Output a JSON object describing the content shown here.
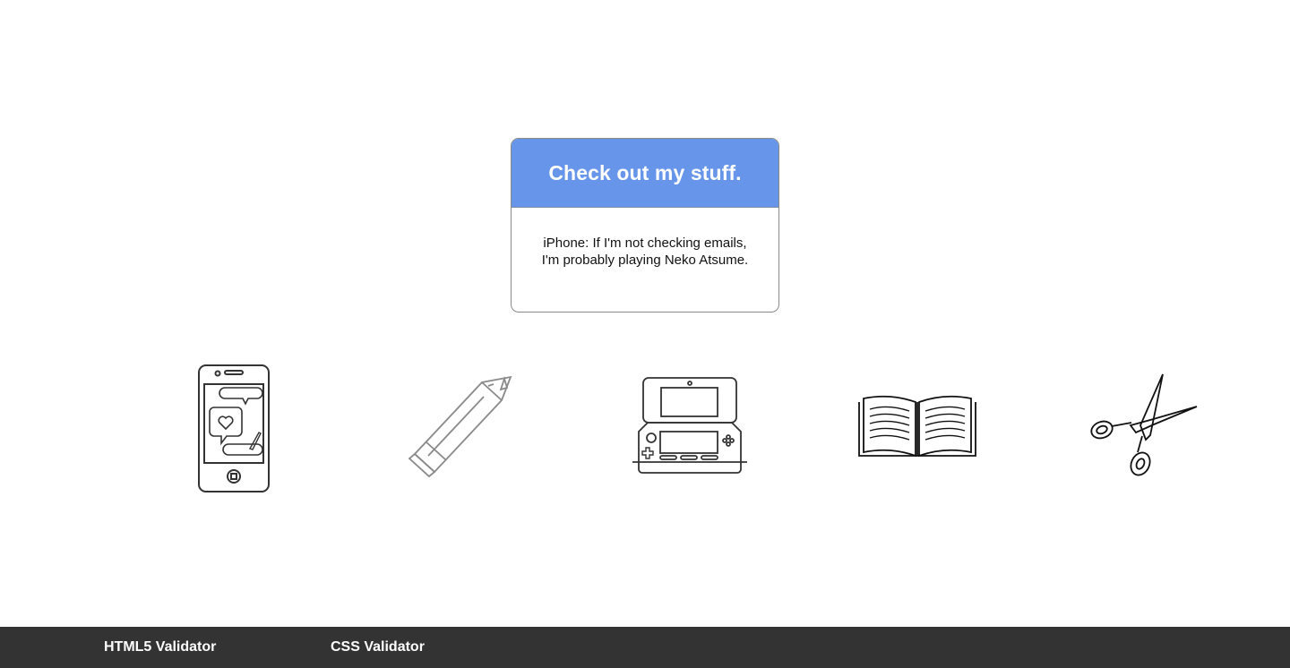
{
  "card": {
    "title": "Check out my stuff.",
    "description": "iPhone: If I'm not checking emails, I'm probably playing Neko Atsume."
  },
  "icons": [
    {
      "name": "iphone-icon"
    },
    {
      "name": "pencil-icon"
    },
    {
      "name": "nintendo-3ds-icon"
    },
    {
      "name": "open-book-icon"
    },
    {
      "name": "scissors-icon"
    }
  ],
  "footer": {
    "links": [
      {
        "label": "HTML5 Validator"
      },
      {
        "label": "CSS Validator"
      }
    ]
  },
  "colors": {
    "header_blue": "#6695e9",
    "footer_bg": "#333333"
  }
}
